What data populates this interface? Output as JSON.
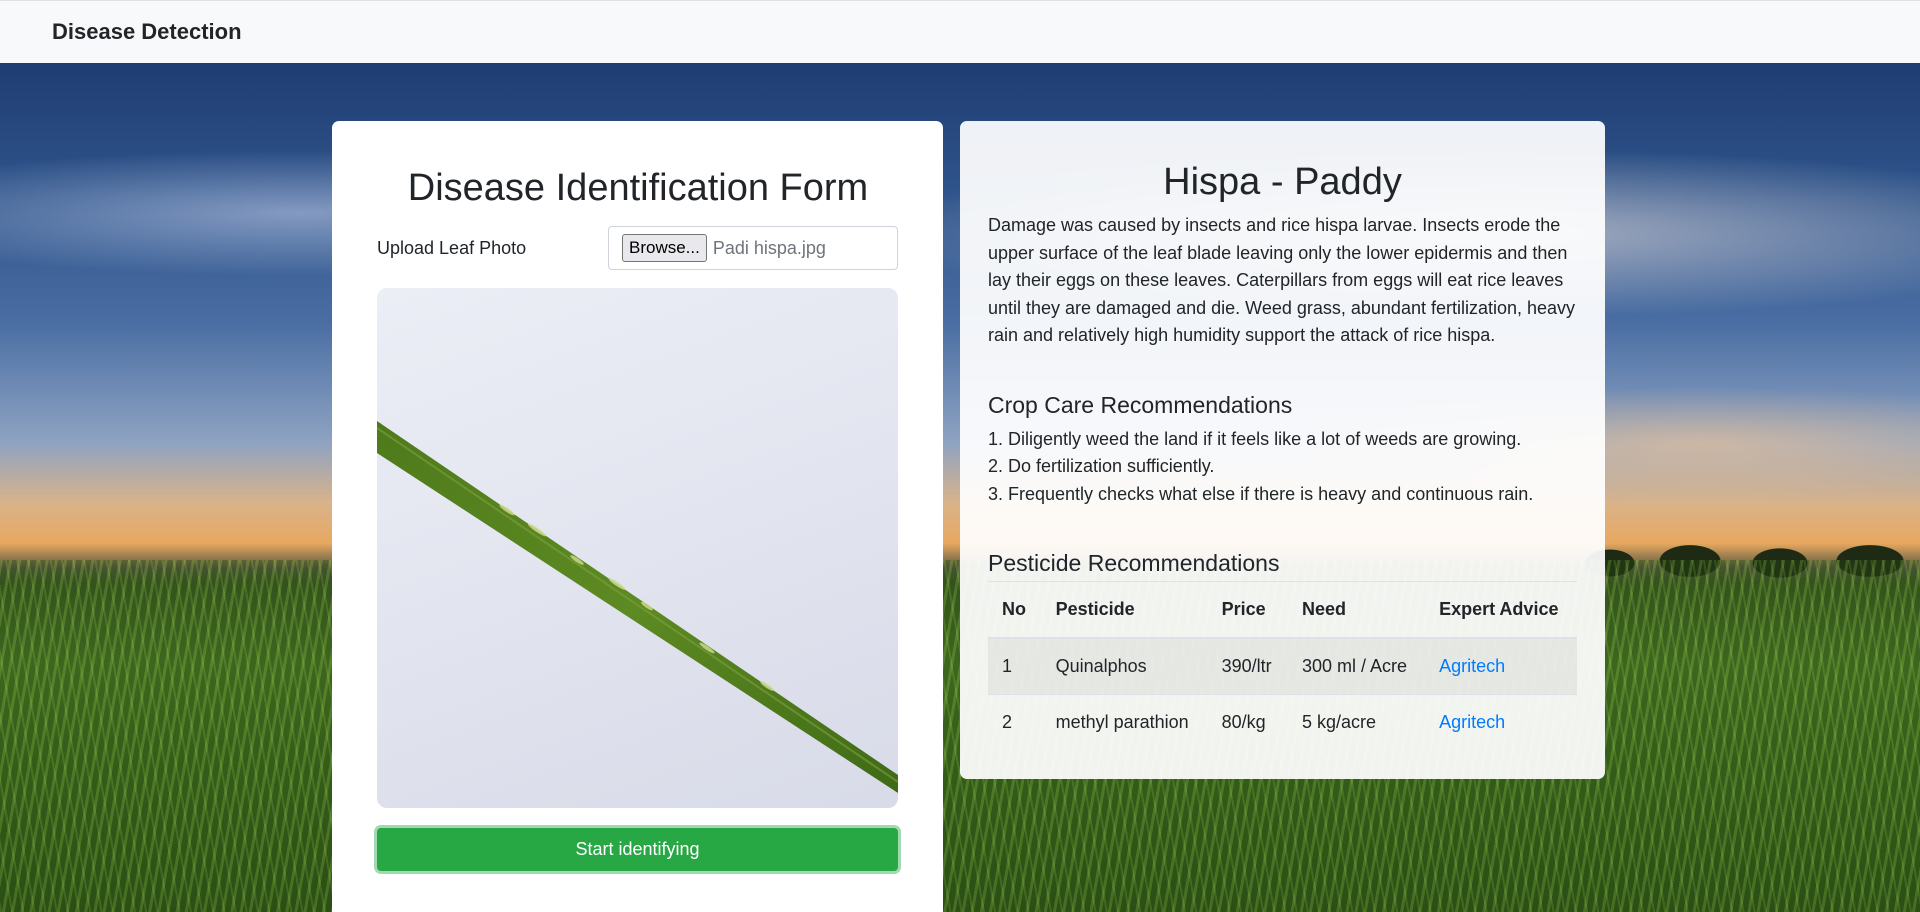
{
  "navbar": {
    "brand": "Disease Detection"
  },
  "form": {
    "title": "Disease Identification Form",
    "upload_label": "Upload Leaf Photo",
    "browse_label": "Browse...",
    "file_name": "Padi hispa.jpg",
    "submit_label": "Start identifying"
  },
  "result": {
    "title": "Hispa - Paddy",
    "description": "Damage was caused by insects and rice hispa larvae. Insects erode the upper surface of the leaf blade leaving only the lower epidermis and then lay their eggs on these leaves. Caterpillars from eggs will eat rice leaves until they are damaged and die. Weed grass, abundant fertilization, heavy rain and relatively high humidity support the attack of rice hispa.",
    "care_heading": "Crop Care Recommendations",
    "care_items": [
      "1. Diligently weed the land if it feels like a lot of weeds are growing.",
      "2. Do fertilization sufficiently.",
      "3. Frequently checks what else if there is heavy and continuous rain."
    ],
    "pesticide_heading": "Pesticide Recommendations",
    "table": {
      "headers": [
        "No",
        "Pesticide",
        "Price",
        "Need",
        "Expert Advice"
      ],
      "rows": [
        {
          "no": "1",
          "pesticide": "Quinalphos",
          "price": "390/ltr",
          "need": "300 ml / Acre",
          "advice": "Agritech"
        },
        {
          "no": "2",
          "pesticide": "methyl parathion",
          "price": "80/kg",
          "need": "5 kg/acre",
          "advice": "Agritech"
        }
      ]
    }
  },
  "colors": {
    "submit_button": "#28a745",
    "link": "#007bff",
    "navbar_bg": "#f8f9fa"
  }
}
